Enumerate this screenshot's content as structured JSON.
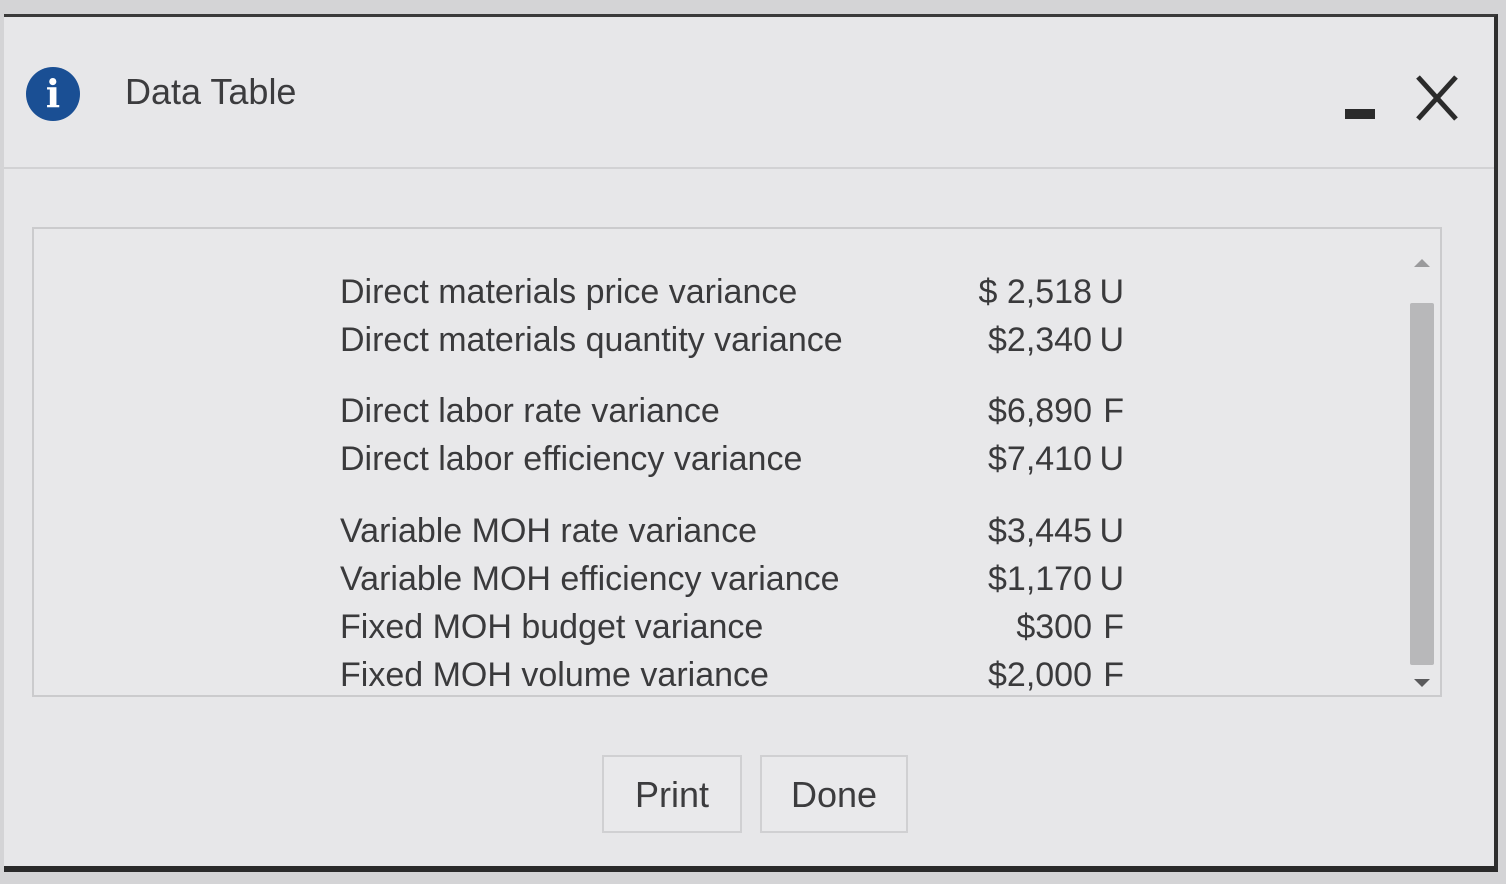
{
  "window": {
    "title": "Data Table",
    "info_icon_glyph": "i",
    "accent_color": "#1a4f94"
  },
  "rows": [
    {
      "label": "Direct materials price variance",
      "amount": "$ 2,518",
      "flag": "U"
    },
    {
      "label": "Direct materials quantity variance",
      "amount": "$2,340",
      "flag": "U"
    },
    {
      "label": "Direct labor rate variance",
      "amount": "$6,890",
      "flag": "F"
    },
    {
      "label": "Direct labor efficiency variance",
      "amount": "$7,410",
      "flag": "U"
    },
    {
      "label": "Variable MOH rate variance",
      "amount": "$3,445",
      "flag": "U"
    },
    {
      "label": "Variable MOH efficiency variance",
      "amount": "$1,170",
      "flag": "U"
    },
    {
      "label": "Fixed MOH budget variance",
      "amount": "$300",
      "flag": "F"
    },
    {
      "label": "Fixed MOH volume variance",
      "amount": "$2,000",
      "flag": "F"
    }
  ],
  "buttons": {
    "print_label": "Print",
    "done_label": "Done"
  }
}
